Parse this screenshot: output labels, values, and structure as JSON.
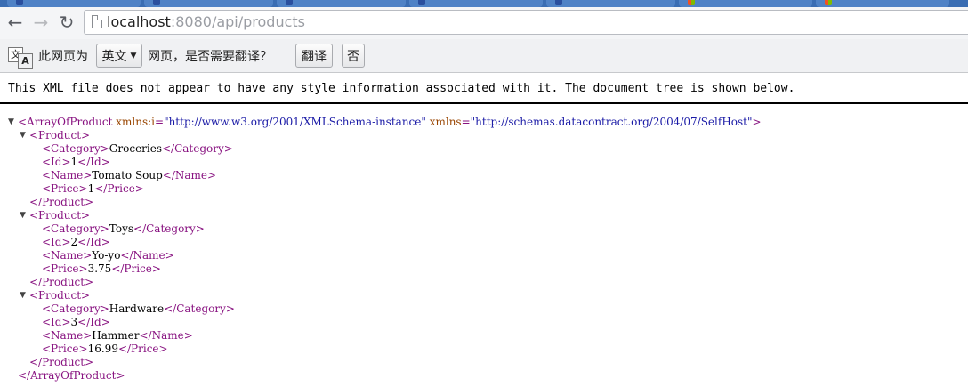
{
  "browser": {
    "url_host": "localhost",
    "url_rest": ":8080/api/products"
  },
  "translate_bar": {
    "prefix": "此网页为",
    "language": "英文",
    "question": "网页，是否需要翻译？",
    "translate_button": "翻译",
    "no_button": "否",
    "icon_glyph_1": "文",
    "icon_glyph_2": "A"
  },
  "notice": "This XML file does not appear to have any style information associated with it. The document tree is shown below.",
  "xml": {
    "root_open": "<ArrayOfProduct",
    "root_attr1_name": "xmlns:i",
    "root_attr1_value": "\"http://www.w3.org/2001/XMLSchema-instance\"",
    "root_attr2_name": "xmlns",
    "root_attr2_value": "\"http://schemas.datacontract.org/2004/07/SelfHost\"",
    "root_open_end": ">",
    "root_close": "</ArrayOfProduct>",
    "product_open": "<Product>",
    "product_close": "</Product>",
    "products": [
      {
        "category": "Groceries",
        "id": "1",
        "name": "Tomato Soup",
        "price": "1"
      },
      {
        "category": "Toys",
        "id": "2",
        "name": "Yo-yo",
        "price": "3.75"
      },
      {
        "category": "Hardware",
        "id": "3",
        "name": "Hammer",
        "price": "16.99"
      }
    ],
    "field_tags": {
      "category_open": "<Category>",
      "category_close": "</Category>",
      "id_open": "<Id>",
      "id_close": "</Id>",
      "name_open": "<Name>",
      "name_close": "</Name>",
      "price_open": "<Price>",
      "price_close": "</Price>"
    }
  }
}
